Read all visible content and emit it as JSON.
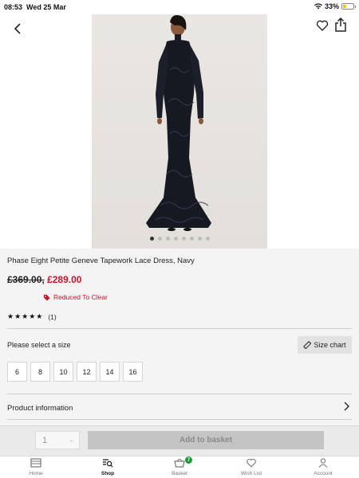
{
  "status_bar": {
    "time": "08:53",
    "date": "Wed 25 Mar",
    "battery": "33%",
    "battery_level": 0.33
  },
  "header": {
    "back_icon": "chevron-left-icon",
    "favourite_icon": "heart-outline-icon",
    "share_icon": "share-icon"
  },
  "gallery": {
    "image_count": 8,
    "active_index": 0
  },
  "product": {
    "title": "Phase Eight Petite Geneve Tapework Lace Dress, Navy",
    "was_price": "£369.00,",
    "now_price": "£289.00",
    "promo_label": "Reduced To Clear",
    "stars": "★★★★★",
    "rating_count": "(1)",
    "rating": 5,
    "size_prompt": "Please select a size",
    "size_chart_label": "Size chart",
    "sizes": [
      "6",
      "8",
      "10",
      "12",
      "14",
      "16"
    ],
    "product_info_label": "Product information"
  },
  "basket_bar": {
    "quantity": "1",
    "quantity_chevron": "-",
    "add_label": "Add to basket"
  },
  "tabs": [
    {
      "label": "Home",
      "icon": "home-icon",
      "active": false
    },
    {
      "label": "Shop",
      "icon": "shop-search-icon",
      "active": true
    },
    {
      "label": "Basket",
      "icon": "basket-icon",
      "active": false,
      "badge": "7"
    },
    {
      "label": "Wish List",
      "icon": "heart-icon",
      "active": false
    },
    {
      "label": "Account",
      "icon": "person-icon",
      "active": false
    }
  ],
  "colors": {
    "sale_red": "#d0112b",
    "badge_green": "#1a9a3a",
    "info_background": "#f4f4f4"
  }
}
